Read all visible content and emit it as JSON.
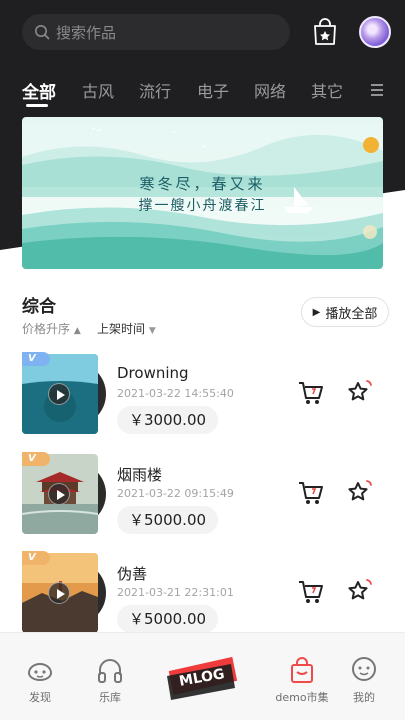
{
  "search": {
    "placeholder": "搜索作品",
    "icon": "search-icon"
  },
  "header": {
    "bag_icon": "shopping-bag-star-icon",
    "avatar_icon": "avatar"
  },
  "tabs": [
    {
      "label": "全部",
      "active": true
    },
    {
      "label": "古风",
      "active": false
    },
    {
      "label": "流行",
      "active": false
    },
    {
      "label": "电子",
      "active": false
    },
    {
      "label": "网络",
      "active": false
    },
    {
      "label": "其它",
      "active": false
    }
  ],
  "tabs_menu_icon": "menu-icon",
  "banner": {
    "line1": "寒冬尽，春又来",
    "line2": "撑一艘小舟渡春江"
  },
  "section": {
    "title": "综合",
    "sort_price": "价格升序",
    "sort_time": "上架时间",
    "play_all": "播放全部"
  },
  "items": [
    {
      "title": "Drowning",
      "date": "2021-03-22 14:55:40",
      "price": "￥3000.00",
      "badge": "V",
      "badge_color": "#7fb2f0"
    },
    {
      "title": "烟雨楼",
      "date": "2021-03-22 09:15:49",
      "price": "￥5000.00",
      "badge": "V",
      "badge_color": "#f0b36a"
    },
    {
      "title": "伪善",
      "date": "2021-03-21 22:31:01",
      "price": "￥5000.00",
      "badge": "V",
      "badge_color": "#f0b36a"
    }
  ],
  "bottom_nav": [
    {
      "label": "发现",
      "icon": "discover-icon",
      "active": false
    },
    {
      "label": "乐库",
      "icon": "headphones-icon",
      "active": false
    },
    {
      "label": "MLOG",
      "icon": "mlog-icon",
      "active": false
    },
    {
      "label": "demo市集",
      "icon": "market-bag-icon",
      "active": true
    },
    {
      "label": "我的",
      "icon": "profile-icon",
      "active": false
    }
  ],
  "colors": {
    "accent": "#ef4a4a",
    "header_bg": "#1f1f21",
    "banner_text": "#1d5e66"
  }
}
